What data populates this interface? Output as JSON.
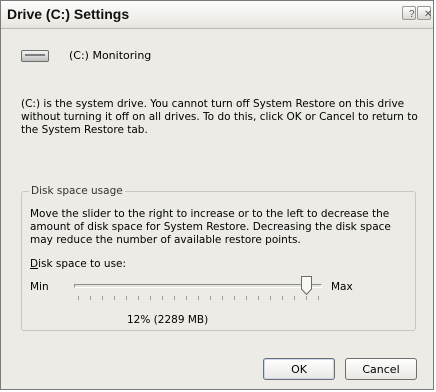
{
  "window": {
    "title": "Drive (C:) Settings",
    "help_button": "?",
    "close_button": "✕"
  },
  "drive": {
    "label": "(C:) Monitoring",
    "icon": "drive-icon"
  },
  "info_text": "(C:) is the system drive. You cannot turn off System Restore on this drive without turning it off on all drives. To do this, click OK or Cancel to return to the System Restore tab.",
  "disk_space": {
    "group_title": "Disk space usage",
    "description": "Move the slider to the right to increase or to the left to decrease the amount of disk space for System Restore. Decreasing the disk space may reduce the number of available restore points.",
    "use_label": "Disk space to use:",
    "use_label_mnemonic": "D",
    "use_label_rest": "isk space to use:",
    "min_label": "Min",
    "max_label": "Max",
    "slider_value_fraction": 0.95,
    "value_text": "12% (2289 MB)"
  },
  "buttons": {
    "ok": "OK",
    "cancel": "Cancel"
  },
  "colors": {
    "dialog_bg": "#ecebe6",
    "title_text": "#111111"
  }
}
